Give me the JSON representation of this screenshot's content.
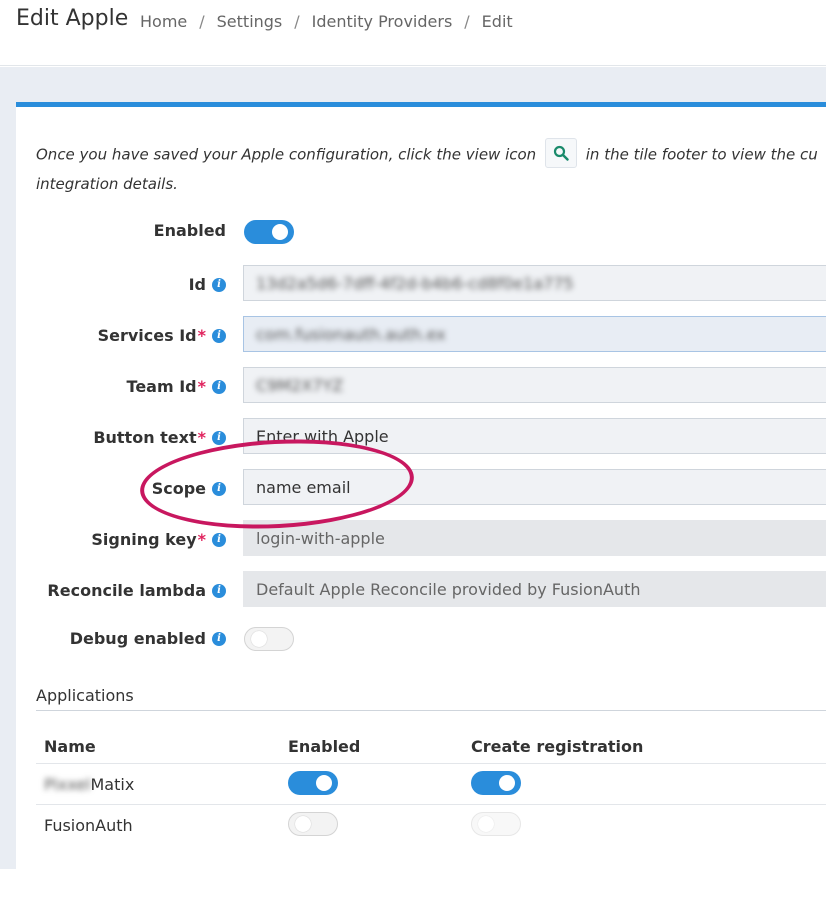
{
  "header": {
    "title": "Edit Apple",
    "breadcrumb": [
      "Home",
      "Settings",
      "Identity Providers",
      "Edit"
    ],
    "separator": "/"
  },
  "intro": {
    "before_icon": "Once you have saved your Apple configuration, click the view icon",
    "icon": "search-icon",
    "after_icon": "in the tile footer to view the cu",
    "line2": "integration details."
  },
  "form": {
    "enabled": {
      "label": "Enabled",
      "value": true
    },
    "id": {
      "label": "Id",
      "value": "13d2a5d6-7dff-4f2d-b4b6-cd8f0e1a775"
    },
    "services_id": {
      "label": "Services Id",
      "required": "*",
      "value": "com.fusionauth.auth.ex"
    },
    "team_id": {
      "label": "Team Id",
      "required": "*",
      "value": "C9M2X7YZ"
    },
    "button_text": {
      "label": "Button text",
      "required": "*",
      "value": "Enter with Apple"
    },
    "scope": {
      "label": "Scope",
      "value": "name email"
    },
    "signing_key": {
      "label": "Signing key",
      "required": "*",
      "value": "login-with-apple"
    },
    "reconcile_lambda": {
      "label": "Reconcile lambda",
      "value": "Default Apple Reconcile provided by FusionAuth"
    },
    "debug_enabled": {
      "label": "Debug enabled",
      "value": false
    }
  },
  "applications": {
    "heading": "Applications",
    "columns": [
      "Name",
      "Enabled",
      "Create registration"
    ],
    "rows": [
      {
        "name_blur": "Pixxel",
        "name": "Matix",
        "enabled": true,
        "create_registration": true
      },
      {
        "name": "FusionAuth",
        "enabled": false,
        "create_registration": false
      }
    ]
  },
  "colors": {
    "accent": "#2a8ddb",
    "required": "#e0245e",
    "annotation": "#c8175f"
  }
}
